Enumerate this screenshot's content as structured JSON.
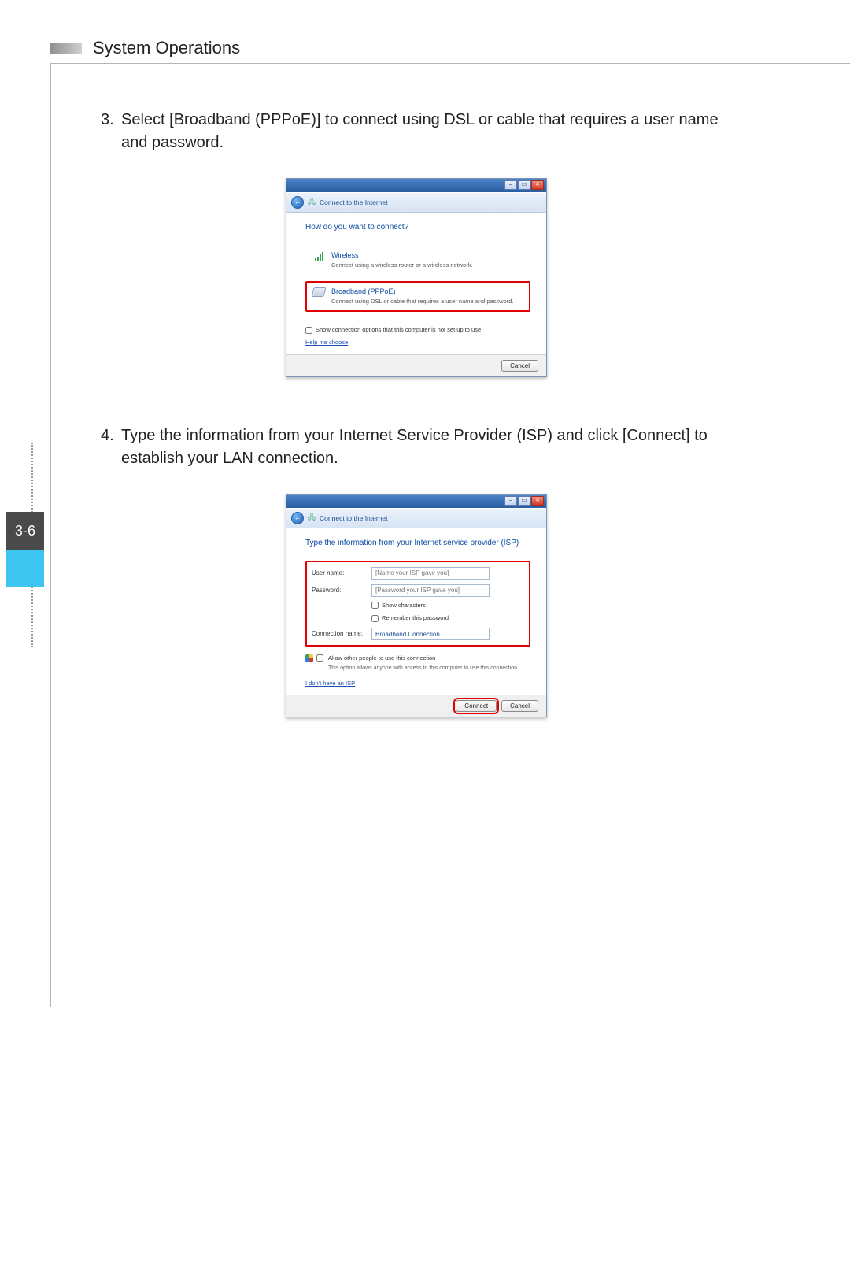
{
  "header": {
    "title": "System Operations"
  },
  "pagenum": "3-6",
  "steps": [
    {
      "num": "3.",
      "text": "Select [Broadband (PPPoE)] to connect using DSL or cable that requires a user name and password."
    },
    {
      "num": "4.",
      "text": "Type the information from your Internet Service Provider (ISP) and click [Connect] to establish your LAN connection."
    }
  ],
  "dialog1": {
    "breadcrumb": "Connect to the Internet",
    "heading": "How do you want to connect?",
    "options": [
      {
        "title": "Wireless",
        "desc": "Connect using a wireless router or a wireless network.",
        "highlight": false
      },
      {
        "title": "Broadband (PPPoE)",
        "desc": "Connect using DSL or cable that requires a user name and password.",
        "highlight": true
      }
    ],
    "show_unavailable": "Show connection options that this computer is not set up to use",
    "help_link": "Help me choose",
    "cancel": "Cancel"
  },
  "dialog2": {
    "breadcrumb": "Connect to the Internet",
    "heading": "Type the information from your Internet service provider (ISP)",
    "fields": {
      "username_label": "User name:",
      "username_placeholder": "[Name your ISP gave you]",
      "password_label": "Password:",
      "password_placeholder": "[Password your ISP gave you]",
      "showchars": "Show characters",
      "remember": "Remember this password",
      "conn_label": "Connection name:",
      "conn_value": "Broadband Connection"
    },
    "allow_others": "Allow other people to use this connection",
    "allow_others_sub": "This option allows anyone with access to this computer to use this connection.",
    "no_isp_link": "I don't have an ISP",
    "connect": "Connect",
    "cancel": "Cancel"
  }
}
